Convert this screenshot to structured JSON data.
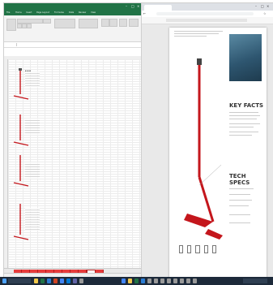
{
  "excel": {
    "title": "",
    "tabs": [
      "File",
      "Home",
      "Insert",
      "Page Layout",
      "Formulas",
      "Data",
      "Review",
      "View"
    ],
    "sheet_sections": [
      {
        "label": "",
        "heading": ""
      },
      {
        "label": "",
        "heading": ""
      },
      {
        "label": "",
        "heading": ""
      },
      {
        "label": "",
        "heading": ""
      }
    ],
    "sheet_tabs_count": 11
  },
  "pdf": {
    "tab_title": "",
    "key_facts_heading": "KEY FACTS",
    "tech_specs_heading": "TECH SPECS",
    "callouts": [
      "",
      "",
      "",
      "",
      "",
      "",
      ""
    ],
    "specs": [
      {
        "label": "",
        "value": ""
      },
      {
        "label": "",
        "value": ""
      },
      {
        "label": "",
        "value": ""
      },
      {
        "label": "",
        "value": ""
      },
      {
        "label": "",
        "value": ""
      },
      {
        "label": "",
        "value": ""
      }
    ],
    "footer_code": ""
  },
  "colors": {
    "excel_green": "#217346",
    "sheet_tab_red": "#e63c3c",
    "foil_red": "#c4161c",
    "taskbar": "#1d2a3a",
    "photo_blue": "#2e5670"
  }
}
